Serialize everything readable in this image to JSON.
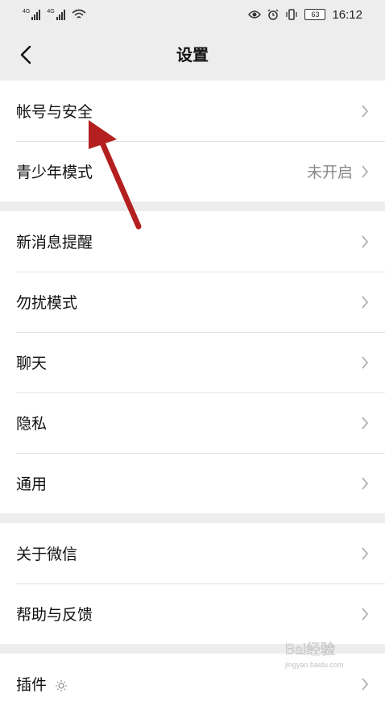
{
  "status_bar": {
    "time": "16:12",
    "battery": "63",
    "network_1": "4G",
    "network_2": "4G"
  },
  "header": {
    "title": "设置"
  },
  "groups": [
    {
      "items": [
        {
          "label": "帐号与安全",
          "value": ""
        },
        {
          "label": "青少年模式",
          "value": "未开启"
        }
      ]
    },
    {
      "items": [
        {
          "label": "新消息提醒",
          "value": ""
        },
        {
          "label": "勿扰模式",
          "value": ""
        },
        {
          "label": "聊天",
          "value": ""
        },
        {
          "label": "隐私",
          "value": ""
        },
        {
          "label": "通用",
          "value": ""
        }
      ]
    },
    {
      "items": [
        {
          "label": "关于微信",
          "value": ""
        },
        {
          "label": "帮助与反馈",
          "value": ""
        }
      ]
    },
    {
      "items": [
        {
          "label": "插件",
          "value": ""
        }
      ]
    }
  ],
  "watermark": {
    "text": "Bai经验",
    "subtext": "jingyan.baidu.com"
  },
  "colors": {
    "background": "#ededed",
    "annotation_arrow": "#b3201f"
  }
}
